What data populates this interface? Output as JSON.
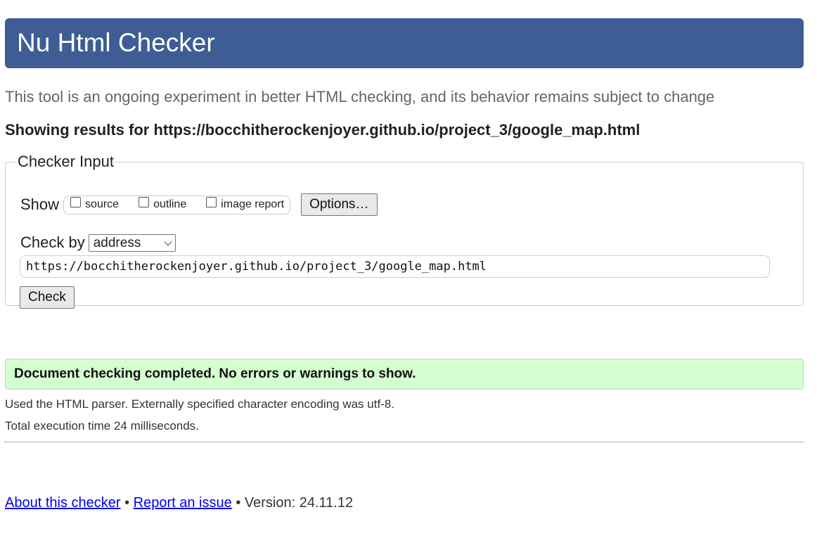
{
  "header": {
    "title": "Nu Html Checker"
  },
  "intro": "This tool is an ongoing experiment in better HTML checking, and its behavior remains subject to change",
  "results_heading": "Showing results for https://bocchitherockenjoyer.github.io/project_3/google_map.html",
  "checker_input": {
    "legend": "Checker Input",
    "show_label": "Show",
    "options": [
      {
        "label": "source",
        "checked": false
      },
      {
        "label": "outline",
        "checked": false
      },
      {
        "label": "image report",
        "checked": false
      }
    ],
    "options_button": "Options…",
    "check_by_label": "Check by",
    "check_by_value": "address",
    "url_value": "https://bocchitherockenjoyer.github.io/project_3/google_map.html",
    "check_button": "Check"
  },
  "result": {
    "success_message": "Document checking completed. No errors or warnings to show.",
    "parser_info": "Used the HTML parser. Externally specified character encoding was utf-8.",
    "execution_time": "Total execution time 24 milliseconds."
  },
  "footer": {
    "about_link": "About this checker",
    "separator": "•",
    "report_link": "Report an issue",
    "version": "Version: 24.11.12"
  },
  "colors": {
    "header_bg": "#3d5d94",
    "success_bg": "#d4ffd0",
    "link": "#0000ee"
  }
}
